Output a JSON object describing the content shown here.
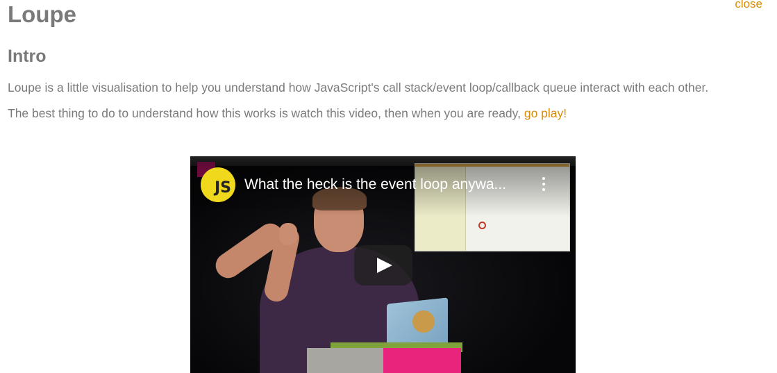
{
  "header": {
    "title": "Loupe",
    "close_label": "close"
  },
  "intro": {
    "heading": "Intro",
    "paragraph1": "Loupe is a little visualisation to help you understand how JavaScript's call stack/event loop/callback queue interact with each other.",
    "paragraph2_prefix": "The best thing to do to understand how this works is watch this video, then when you are ready, ",
    "paragraph2_link": "go play!"
  },
  "video": {
    "title": "What the heck is the event loop anywa...",
    "channel_logo_text": "JS",
    "play_icon": "play-icon",
    "menu_icon": "kebab-menu-icon"
  },
  "colors": {
    "link": "#d98c0a",
    "text": "#7a7a7a",
    "logo_yellow": "#f0d81c"
  }
}
